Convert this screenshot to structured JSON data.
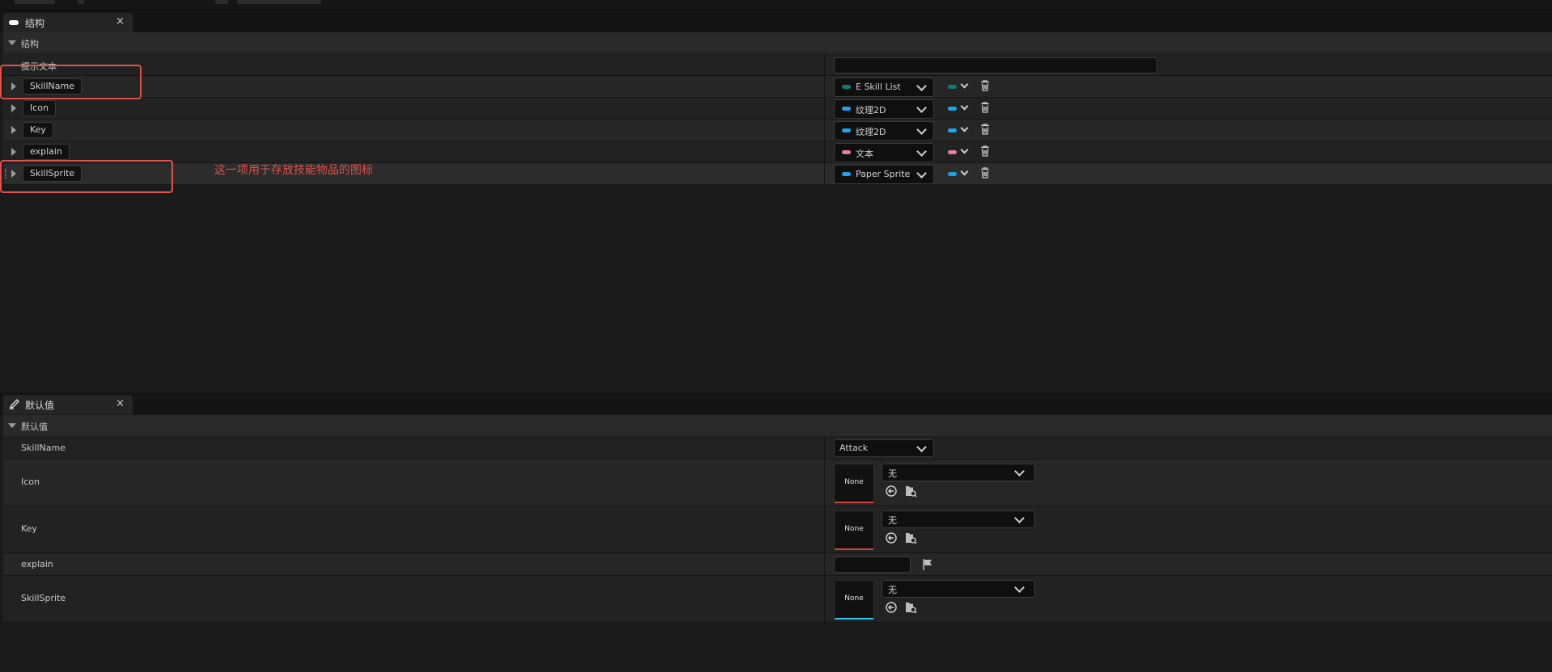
{
  "struct_panel": {
    "tab_title": "结构",
    "tab_icon": "struct-pill-icon",
    "close_glyph": "×",
    "category": "结构",
    "tooltip_label": "提示文本",
    "members": [
      {
        "name": "SkillName",
        "type": "E Skill List",
        "type_color": "#137a6f"
      },
      {
        "name": "Icon",
        "type": "纹理2D",
        "type_color": "#1fa3e8"
      },
      {
        "name": "Key",
        "type": "纹理2D",
        "type_color": "#1fa3e8"
      },
      {
        "name": "explain",
        "type": "文本",
        "type_color": "#e47ea8"
      },
      {
        "name": "SkillSprite",
        "type": "Paper Sprite",
        "type_color": "#1fa3e8"
      }
    ]
  },
  "annotation": "这一项用于存放技能物品的图标",
  "defaults_panel": {
    "tab_title": "默认值",
    "tab_icon": "pencil-icon",
    "close_glyph": "×",
    "category": "默认值",
    "rows": [
      {
        "label": "SkillName",
        "value": "Attack"
      },
      {
        "label": "Icon",
        "thumb": "None",
        "asset": "无",
        "thumb_color": "#d04545"
      },
      {
        "label": "Key",
        "thumb": "None",
        "asset": "无",
        "thumb_color": "#d04545"
      },
      {
        "label": "explain"
      },
      {
        "label": "SkillSprite",
        "thumb": "None",
        "asset": "无",
        "thumb_color": "#2fc6e6"
      }
    ]
  },
  "colors": {
    "highlight": "#e0524d",
    "panel_bg": "#1b1b1b"
  }
}
